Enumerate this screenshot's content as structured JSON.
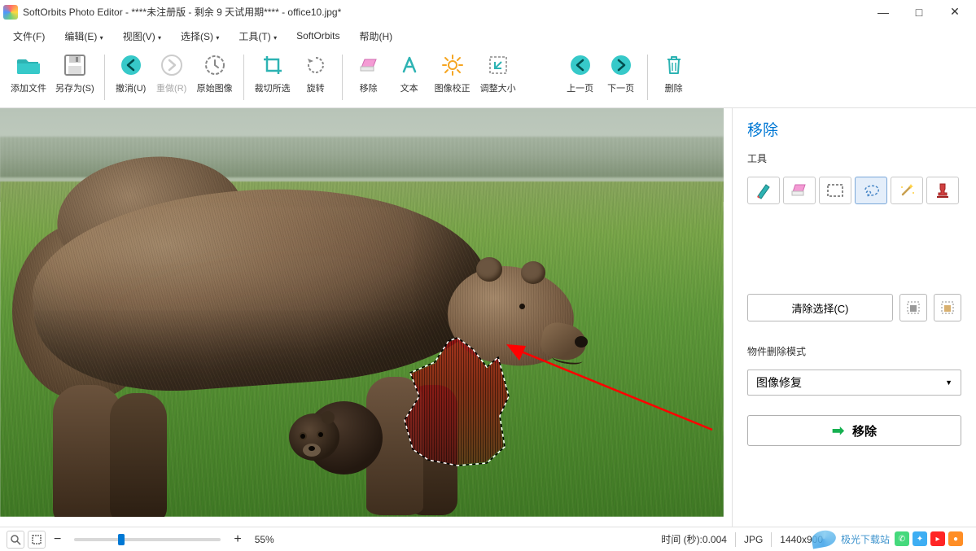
{
  "window": {
    "title": "SoftOrbits Photo Editor - ****未注册版 - 剩余 9 天试用期**** - office10.jpg*",
    "min": "—",
    "max": "□",
    "close": "✕"
  },
  "menu": {
    "file": "文件(F)",
    "edit": "编辑(E)",
    "view": "视图(V)",
    "select": "选择(S)",
    "tools": "工具(T)",
    "softorbits": "SoftOrbits",
    "help": "帮助(H)"
  },
  "toolbar": {
    "add_files": "添加文件",
    "save_as": "另存为(S)",
    "undo": "撤消(U)",
    "redo": "重做(R)",
    "original": "原始图像",
    "crop": "裁切所选",
    "rotate": "旋转",
    "remove": "移除",
    "text": "文本",
    "correction": "图像校正",
    "resize": "调整大小",
    "prev": "上一页",
    "next": "下一页",
    "delete": "删除"
  },
  "sidepanel": {
    "title": "移除",
    "tools_label": "工具",
    "tool_marker": "marker-icon",
    "tool_eraser": "eraser-icon",
    "tool_rect": "rect-select-icon",
    "tool_lasso": "lasso-icon",
    "tool_wand": "wand-icon",
    "tool_stamp": "stamp-icon",
    "clear_btn": "清除选择(C)",
    "mode_label": "物件删除模式",
    "mode_value": "图像修复",
    "remove_btn": "移除"
  },
  "status": {
    "zoom": "55%",
    "minus": "−",
    "plus": "+",
    "time_label": "时间 (秒): ",
    "time_value": "0.004",
    "format": "JPG",
    "dims": "1440x900"
  },
  "watermark": {
    "text": "极光下载站"
  }
}
